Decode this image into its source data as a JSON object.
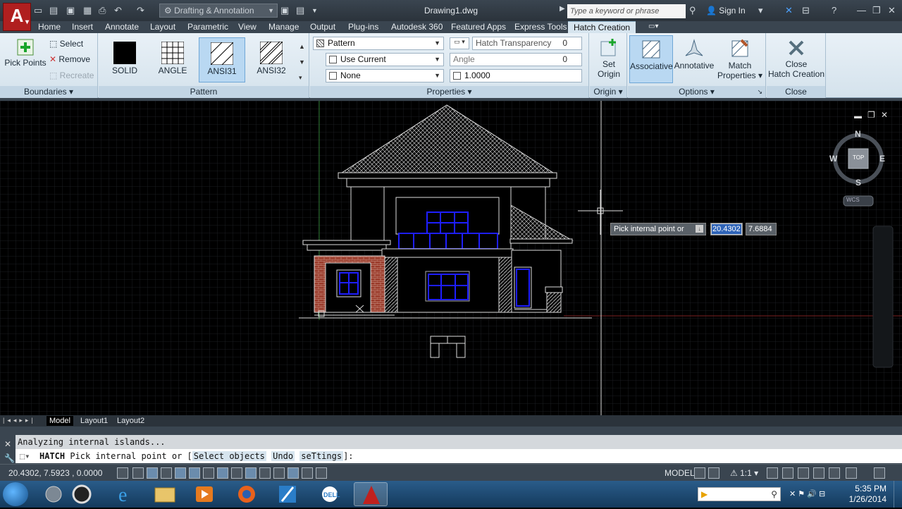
{
  "app": {
    "logo": "A",
    "workspace": "Drafting & Annotation",
    "document_title": "Drawing1.dwg",
    "search_placeholder": "Type a keyword or phrase",
    "sign_in": "Sign In"
  },
  "tabs": [
    "Home",
    "Insert",
    "Annotate",
    "Layout",
    "Parametric",
    "View",
    "Manage",
    "Output",
    "Plug-ins",
    "Autodesk 360",
    "Featured Apps",
    "Express Tools",
    "Hatch Creation"
  ],
  "ribbon": {
    "boundaries": {
      "pick_points": "Pick Points",
      "select": "Select",
      "remove": "Remove",
      "recreate": "Recreate",
      "title": "Boundaries"
    },
    "pattern": {
      "title": "Pattern",
      "tiles": [
        "SOLID",
        "ANGLE",
        "ANSI31",
        "ANSI32"
      ],
      "selected": "ANSI31"
    },
    "properties": {
      "title": "Properties",
      "type": "Pattern",
      "color": "Use Current",
      "background": "None",
      "transparency_label": "Hatch Transparency",
      "transparency_value": "0",
      "angle_label": "Angle",
      "angle_value": "0",
      "scale_value": "1.0000"
    },
    "origin": {
      "set_origin_line1": "Set",
      "set_origin_line2": "Origin",
      "title": "Origin"
    },
    "options": {
      "associative": "Associative",
      "annotative": "Annotative",
      "match_line1": "Match",
      "match_line2": "Properties",
      "title": "Options"
    },
    "close": {
      "line1": "Close",
      "line2": "Hatch Creation",
      "title": "Close"
    }
  },
  "viewcube": {
    "north": "N",
    "south": "S",
    "east": "E",
    "west": "W",
    "face": "TOP",
    "ucs": "WCS"
  },
  "dynamic_input": {
    "prompt": "Pick internal point or",
    "x_value": "20.4302",
    "y_value": "7.6884"
  },
  "layout_tabs": [
    "Model",
    "Layout1",
    "Layout2"
  ],
  "command": {
    "history": "Analyzing internal islands...",
    "name": "HATCH",
    "prompt": "Pick internal point or [",
    "opt1": "Select objects",
    "opt2": "Undo",
    "opt3": "seTtings",
    "end": "]:"
  },
  "status": {
    "coords": "20.4302, 7.5923 , 0.0000",
    "model": "MODEL",
    "scale": "1:1"
  },
  "taskbar": {
    "time": "5:35 PM",
    "date": "1/26/2014"
  }
}
